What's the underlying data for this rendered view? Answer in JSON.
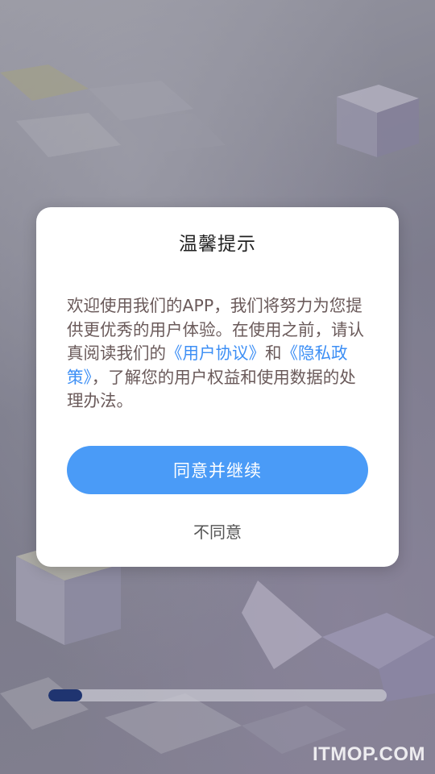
{
  "dialog": {
    "title": "温馨提示",
    "body_intro": "欢迎使用我们的APP，我们将努力为您提供更优秀的用户体验。在使用之前，请认真阅读我们的",
    "user_agreement_link": "《用户协议》",
    "connector": "和",
    "privacy_policy_link": "《隐私政策》",
    "body_outro": "，了解您的用户权益和使用数据的处理办法。",
    "agree_label": "同意并继续",
    "disagree_label": "不同意"
  },
  "loading": {
    "progress": 0.1
  },
  "watermark": "ITMOP.COM",
  "colors": {
    "primary": "#4a9bf7",
    "link": "#3d8ff5",
    "progress_fill": "#1f3470"
  }
}
